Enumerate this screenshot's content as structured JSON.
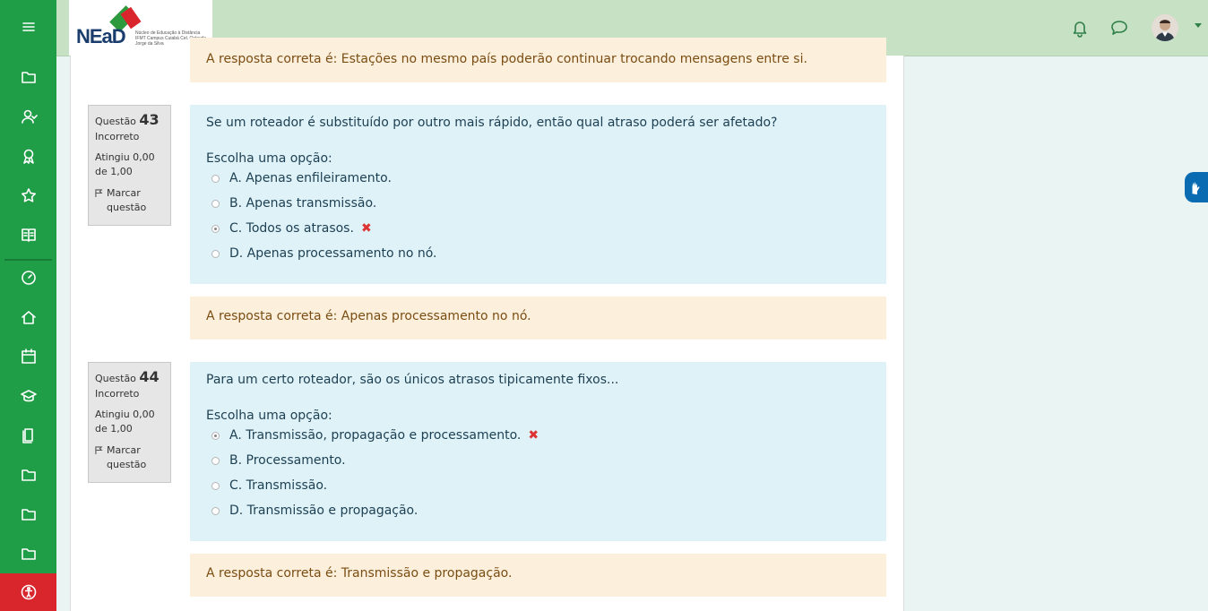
{
  "navbar": {
    "logo_text": "NEaD",
    "logo_subtitle": "Núcleo de Educação à Distância IFMT Campus Cuiabá Cel. Octayde Jorge da Silva"
  },
  "sidebar": {
    "items": [
      {
        "icon": "menu-icon"
      },
      {
        "icon": "folder-icon"
      },
      {
        "icon": "users-icon"
      },
      {
        "icon": "badge-icon"
      },
      {
        "icon": "star-icon"
      },
      {
        "icon": "book-icon"
      },
      {
        "icon": "dashboard-icon"
      },
      {
        "icon": "home-icon"
      },
      {
        "icon": "calendar-icon"
      },
      {
        "icon": "graduation-cap-icon"
      },
      {
        "icon": "files-icon"
      },
      {
        "icon": "folder-icon"
      },
      {
        "icon": "folder-icon"
      },
      {
        "icon": "folder-icon"
      },
      {
        "icon": "accessibility-icon"
      }
    ]
  },
  "previous_feedback": "A resposta correta é: Estações no mesmo país poderão continuar trocando mensagens entre si.",
  "questions": [
    {
      "label": "Questão",
      "number": "43",
      "state": "Incorreto",
      "grade": "Atingiu 0,00 de 1,00",
      "flag_label": "Marcar questão",
      "text": "Se um roteador é substituído por outro mais rápido, então qual atraso poderá ser afetado?",
      "prompt": "Escolha uma opção:",
      "options": [
        {
          "label": "A. Apenas enfileiramento.",
          "checked": false
        },
        {
          "label": "B. Apenas transmissão.",
          "checked": false
        },
        {
          "label": "C. Todos os atrasos.",
          "checked": true
        },
        {
          "label": "D. Apenas processamento no nó.",
          "checked": false
        }
      ],
      "feedback": "A resposta correta é: Apenas processamento no nó."
    },
    {
      "label": "Questão",
      "number": "44",
      "state": "Incorreto",
      "grade": "Atingiu 0,00 de 1,00",
      "flag_label": "Marcar questão",
      "text": "Para um certo roteador, são os únicos atrasos tipicamente fixos...",
      "prompt": "Escolha uma opção:",
      "options": [
        {
          "label": "A. Transmissão, propagação e processamento.",
          "checked": true
        },
        {
          "label": "B. Processamento.",
          "checked": false
        },
        {
          "label": "C. Transmissão.",
          "checked": false
        },
        {
          "label": "D. Transmissão e propagação.",
          "checked": false
        }
      ],
      "feedback": "A resposta correta é: Transmissão e propagação."
    }
  ],
  "colors": {
    "sidebar": "#1f9d47",
    "navbar": "#c6e1c4",
    "incorrect": "#dd3333",
    "question_bg": "#def2f8",
    "feedback_bg": "#fcefdc"
  }
}
